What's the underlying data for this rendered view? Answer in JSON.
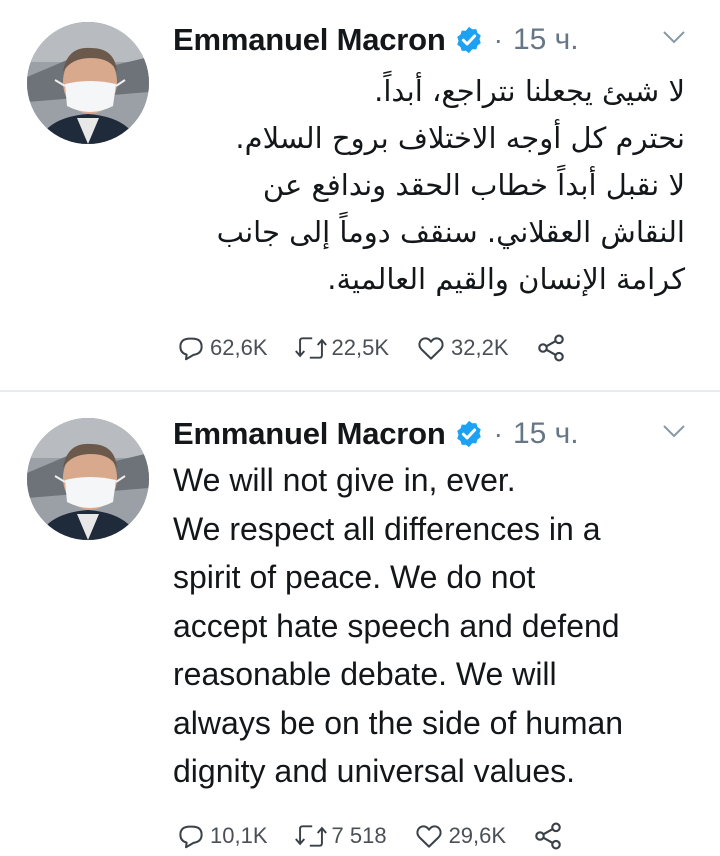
{
  "tweets": [
    {
      "author": "Emmanuel Macron",
      "time": "15 ч.",
      "lines": [
        "لا شيئ يجعلنا نتراجع، أبداً.",
        "نحترم كل أوجه الاختلاف بروح السلام.",
        "لا نقبل أبداً خطاب الحقد وندافع عن",
        "النقاش العقلاني. سنقف دوماً إلى جانب",
        "كرامة الإنسان والقيم العالمية."
      ],
      "replies": "62,6K",
      "retweets": "22,5K",
      "likes": "32,2K"
    },
    {
      "author": "Emmanuel Macron",
      "time": "15 ч.",
      "lines": [
        "We will not give in, ever.",
        "We respect all differences in a",
        "spirit of peace. We do not",
        "accept hate speech and defend",
        "reasonable debate. We will",
        "always be on the side of human",
        "dignity and universal values."
      ],
      "replies": "10,1K",
      "retweets": "7 518",
      "likes": "29,6K"
    }
  ],
  "icons": {
    "verified": "verified-badge-icon",
    "menu": "chevron-down-icon",
    "reply": "reply-icon",
    "retweet": "retweet-icon",
    "like": "heart-icon",
    "share": "share-icon"
  },
  "colors": {
    "verified": "#1da1f2",
    "muted": "#657786",
    "divider": "#e6ecf0"
  }
}
